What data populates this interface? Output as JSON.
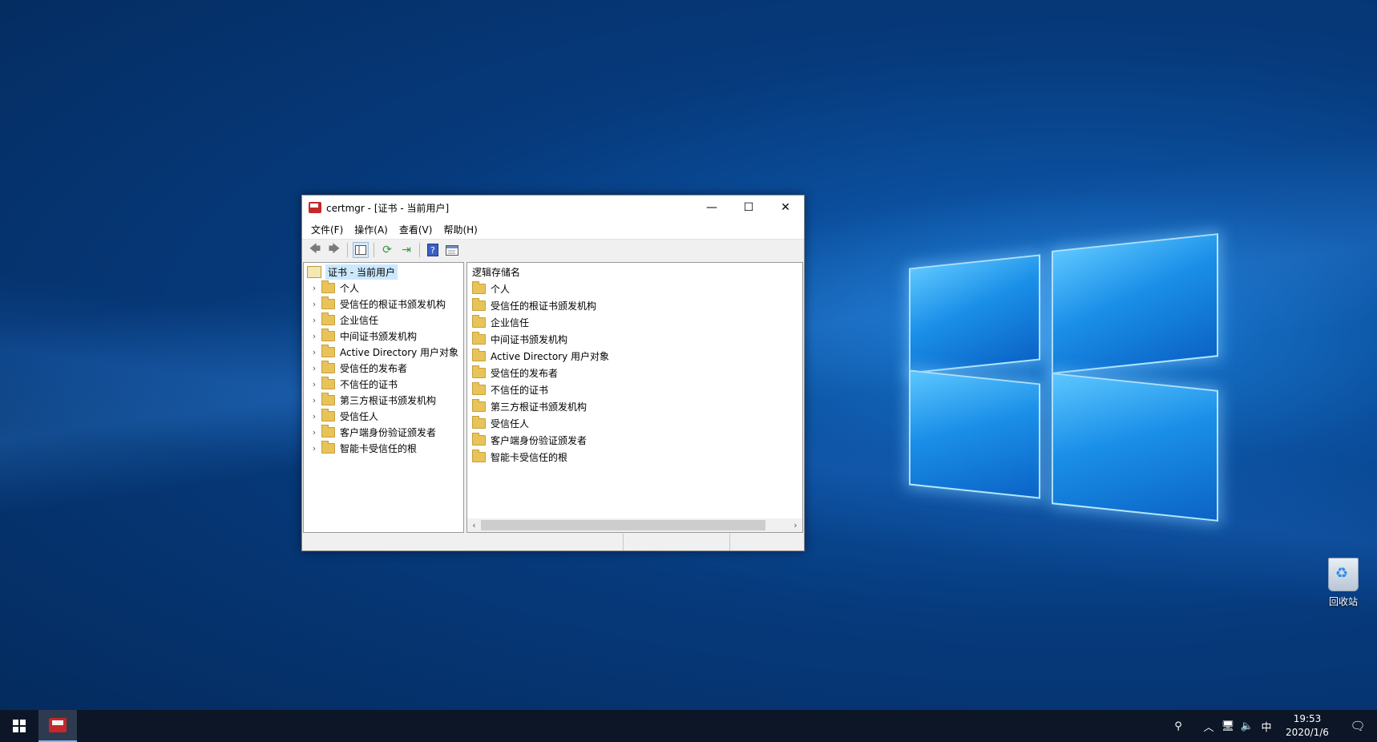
{
  "window": {
    "title": "certmgr - [证书 - 当前用户]",
    "menu": [
      "文件(F)",
      "操作(A)",
      "查看(V)",
      "帮助(H)"
    ],
    "caption": {
      "minimize": "—",
      "maximize": "☐",
      "close": "✕"
    },
    "toolbar_icons": [
      "back-icon",
      "forward-icon",
      "show-hide-tree-icon",
      "refresh-icon",
      "export-list-icon",
      "help-icon",
      "properties-icon"
    ]
  },
  "tree": {
    "root": "证书 - 当前用户",
    "items": [
      "个人",
      "受信任的根证书颁发机构",
      "企业信任",
      "中间证书颁发机构",
      "Active Directory 用户对象",
      "受信任的发布者",
      "不信任的证书",
      "第三方根证书颁发机构",
      "受信任人",
      "客户端身份验证颁发者",
      "智能卡受信任的根"
    ]
  },
  "list": {
    "column_header": "逻辑存储名",
    "items": [
      "个人",
      "受信任的根证书颁发机构",
      "企业信任",
      "中间证书颁发机构",
      "Active Directory 用户对象",
      "受信任的发布者",
      "不信任的证书",
      "第三方根证书颁发机构",
      "受信任人",
      "客户端身份验证颁发者",
      "智能卡受信任的根"
    ]
  },
  "desktop": {
    "recycle_bin_label": "回收站"
  },
  "taskbar": {
    "time": "19:53",
    "date": "2020/1/6",
    "ime": "中",
    "tray_icons": [
      "people-icon",
      "chevron-up-icon",
      "network-icon",
      "volume-icon"
    ]
  }
}
